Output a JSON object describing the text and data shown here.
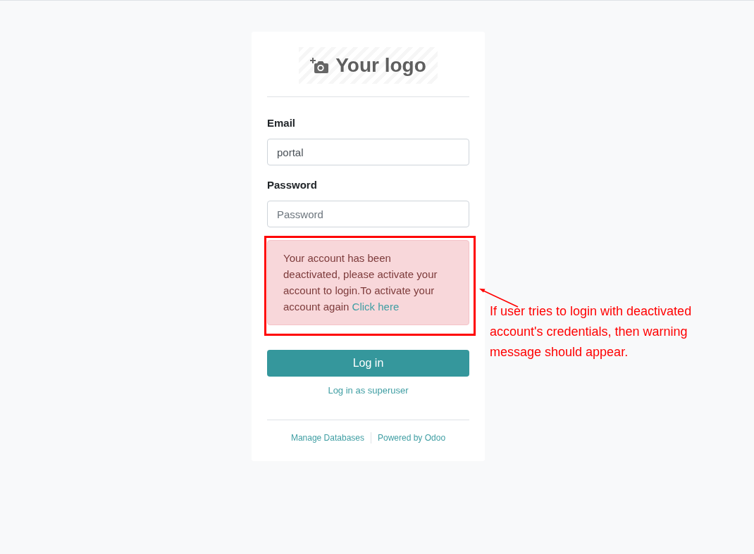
{
  "logo": {
    "text": "Your logo"
  },
  "form": {
    "fields": [
      {
        "label": "Email",
        "value": "portal"
      },
      {
        "label": "Password",
        "placeholder": "Password"
      }
    ],
    "alert": {
      "message": "Your account has been deactivated, please activate your account to login.To activate your account again",
      "link": "Click here"
    },
    "submit": "Log in",
    "secondary_link": "Log in as superuser"
  },
  "footer": {
    "links": [
      "Manage Databases",
      "Powered by Odoo"
    ]
  },
  "annotation": {
    "text": "If user tries to login with deactivated account's credentials, then warning message should appear."
  }
}
